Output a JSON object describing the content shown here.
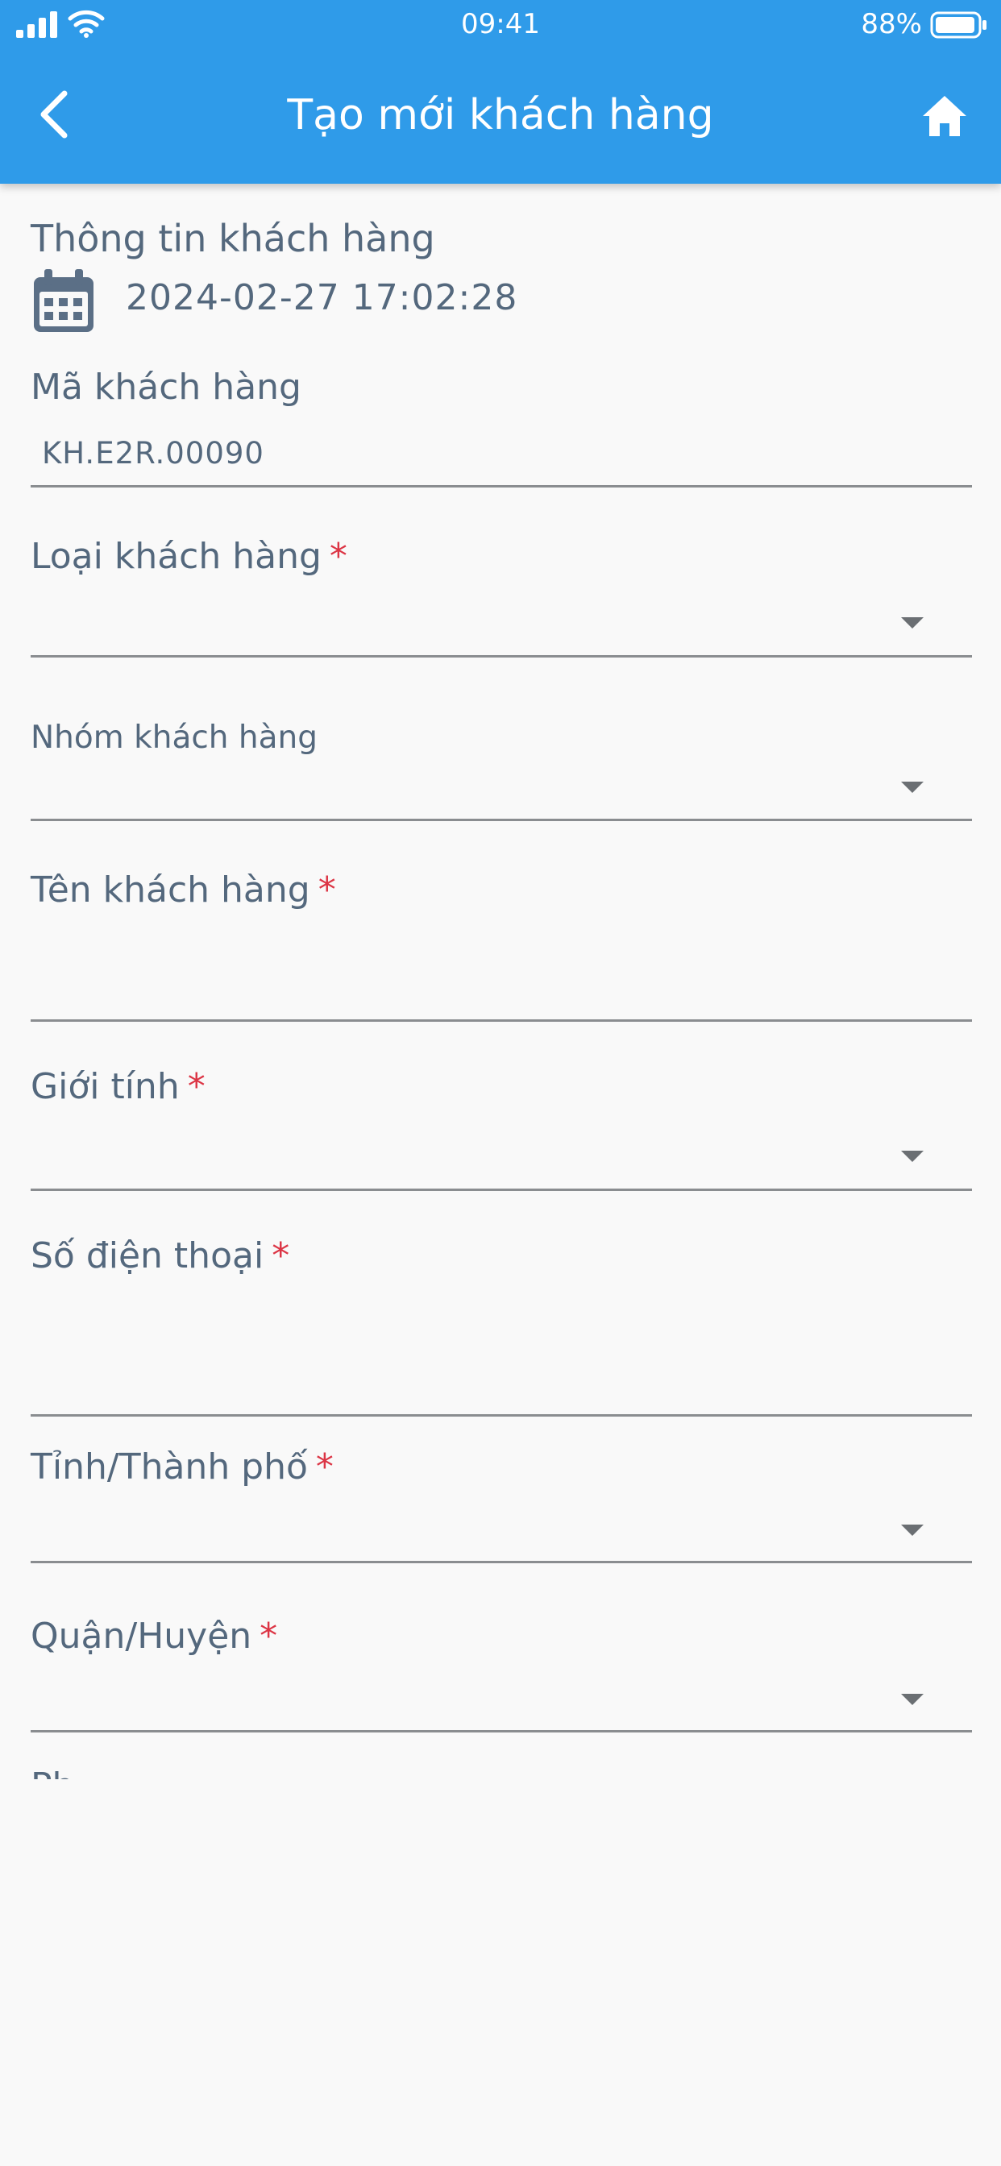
{
  "status_bar": {
    "time": "09:41",
    "battery": "88%"
  },
  "nav": {
    "title": "Tạo mới khách hàng"
  },
  "form": {
    "section_title": "Thông tin khách hàng",
    "created_at": "2024-02-27 17:02:28",
    "customer_code": {
      "label": "Mã khách hàng",
      "value": "KH.E2R.00090"
    },
    "customer_type": {
      "label": "Loại khách hàng",
      "required": "*"
    },
    "customer_group": {
      "label": "Nhóm khách hàng"
    },
    "customer_name": {
      "label": "Tên khách hàng",
      "required": "*"
    },
    "gender": {
      "label": "Giới tính",
      "required": "*"
    },
    "phone": {
      "label": "Số điện thoại",
      "required": "*"
    },
    "province": {
      "label": "Tỉnh/Thành phố",
      "required": "*"
    },
    "district": {
      "label": "Quận/Huyện",
      "required": "*"
    },
    "next_field_partial": "Ph"
  },
  "colors": {
    "header": "#2f9be9",
    "background": "#f9f9f9",
    "text": "#54687d",
    "required": "#dc3545",
    "underline": "#8a8d90"
  },
  "icons": [
    "signal-icon",
    "wifi-icon",
    "battery-icon",
    "back-chevron-icon",
    "home-icon",
    "calendar-icon",
    "dropdown-arrow-icon"
  ]
}
